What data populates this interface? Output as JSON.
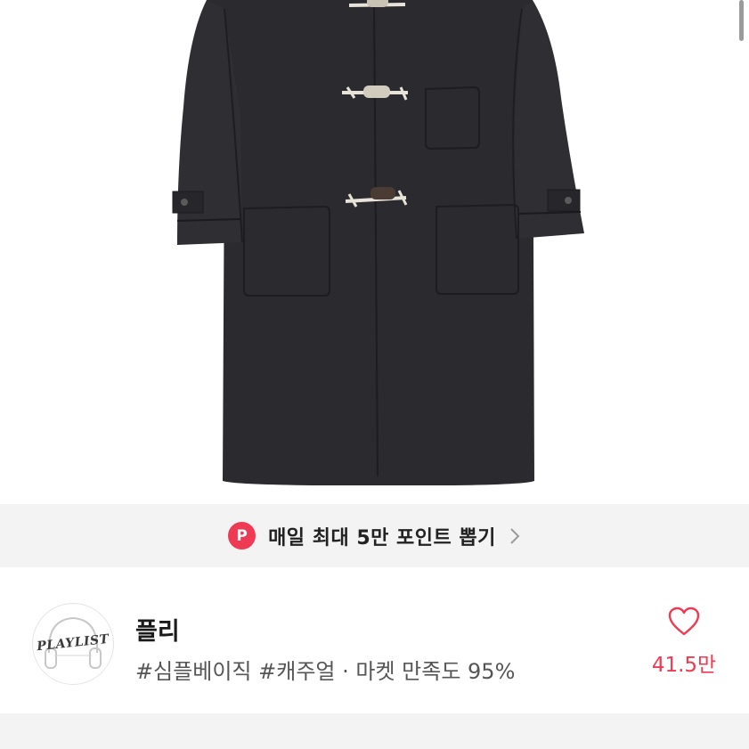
{
  "product": {
    "image_alt": "duffle coat",
    "coat_color": "#2b2a2e"
  },
  "promo": {
    "badge": "P",
    "text": "매일 최대 5만 포인트 뽑기",
    "badge_color": "#ee3a52"
  },
  "seller": {
    "name": "플리",
    "avatar_logo_text": "PLAYLIST",
    "meta": "#심플베이직 #캐주얼 · 마켓 만족도 95%",
    "likes": "41.5만",
    "accent_color": "#ee3a52"
  }
}
